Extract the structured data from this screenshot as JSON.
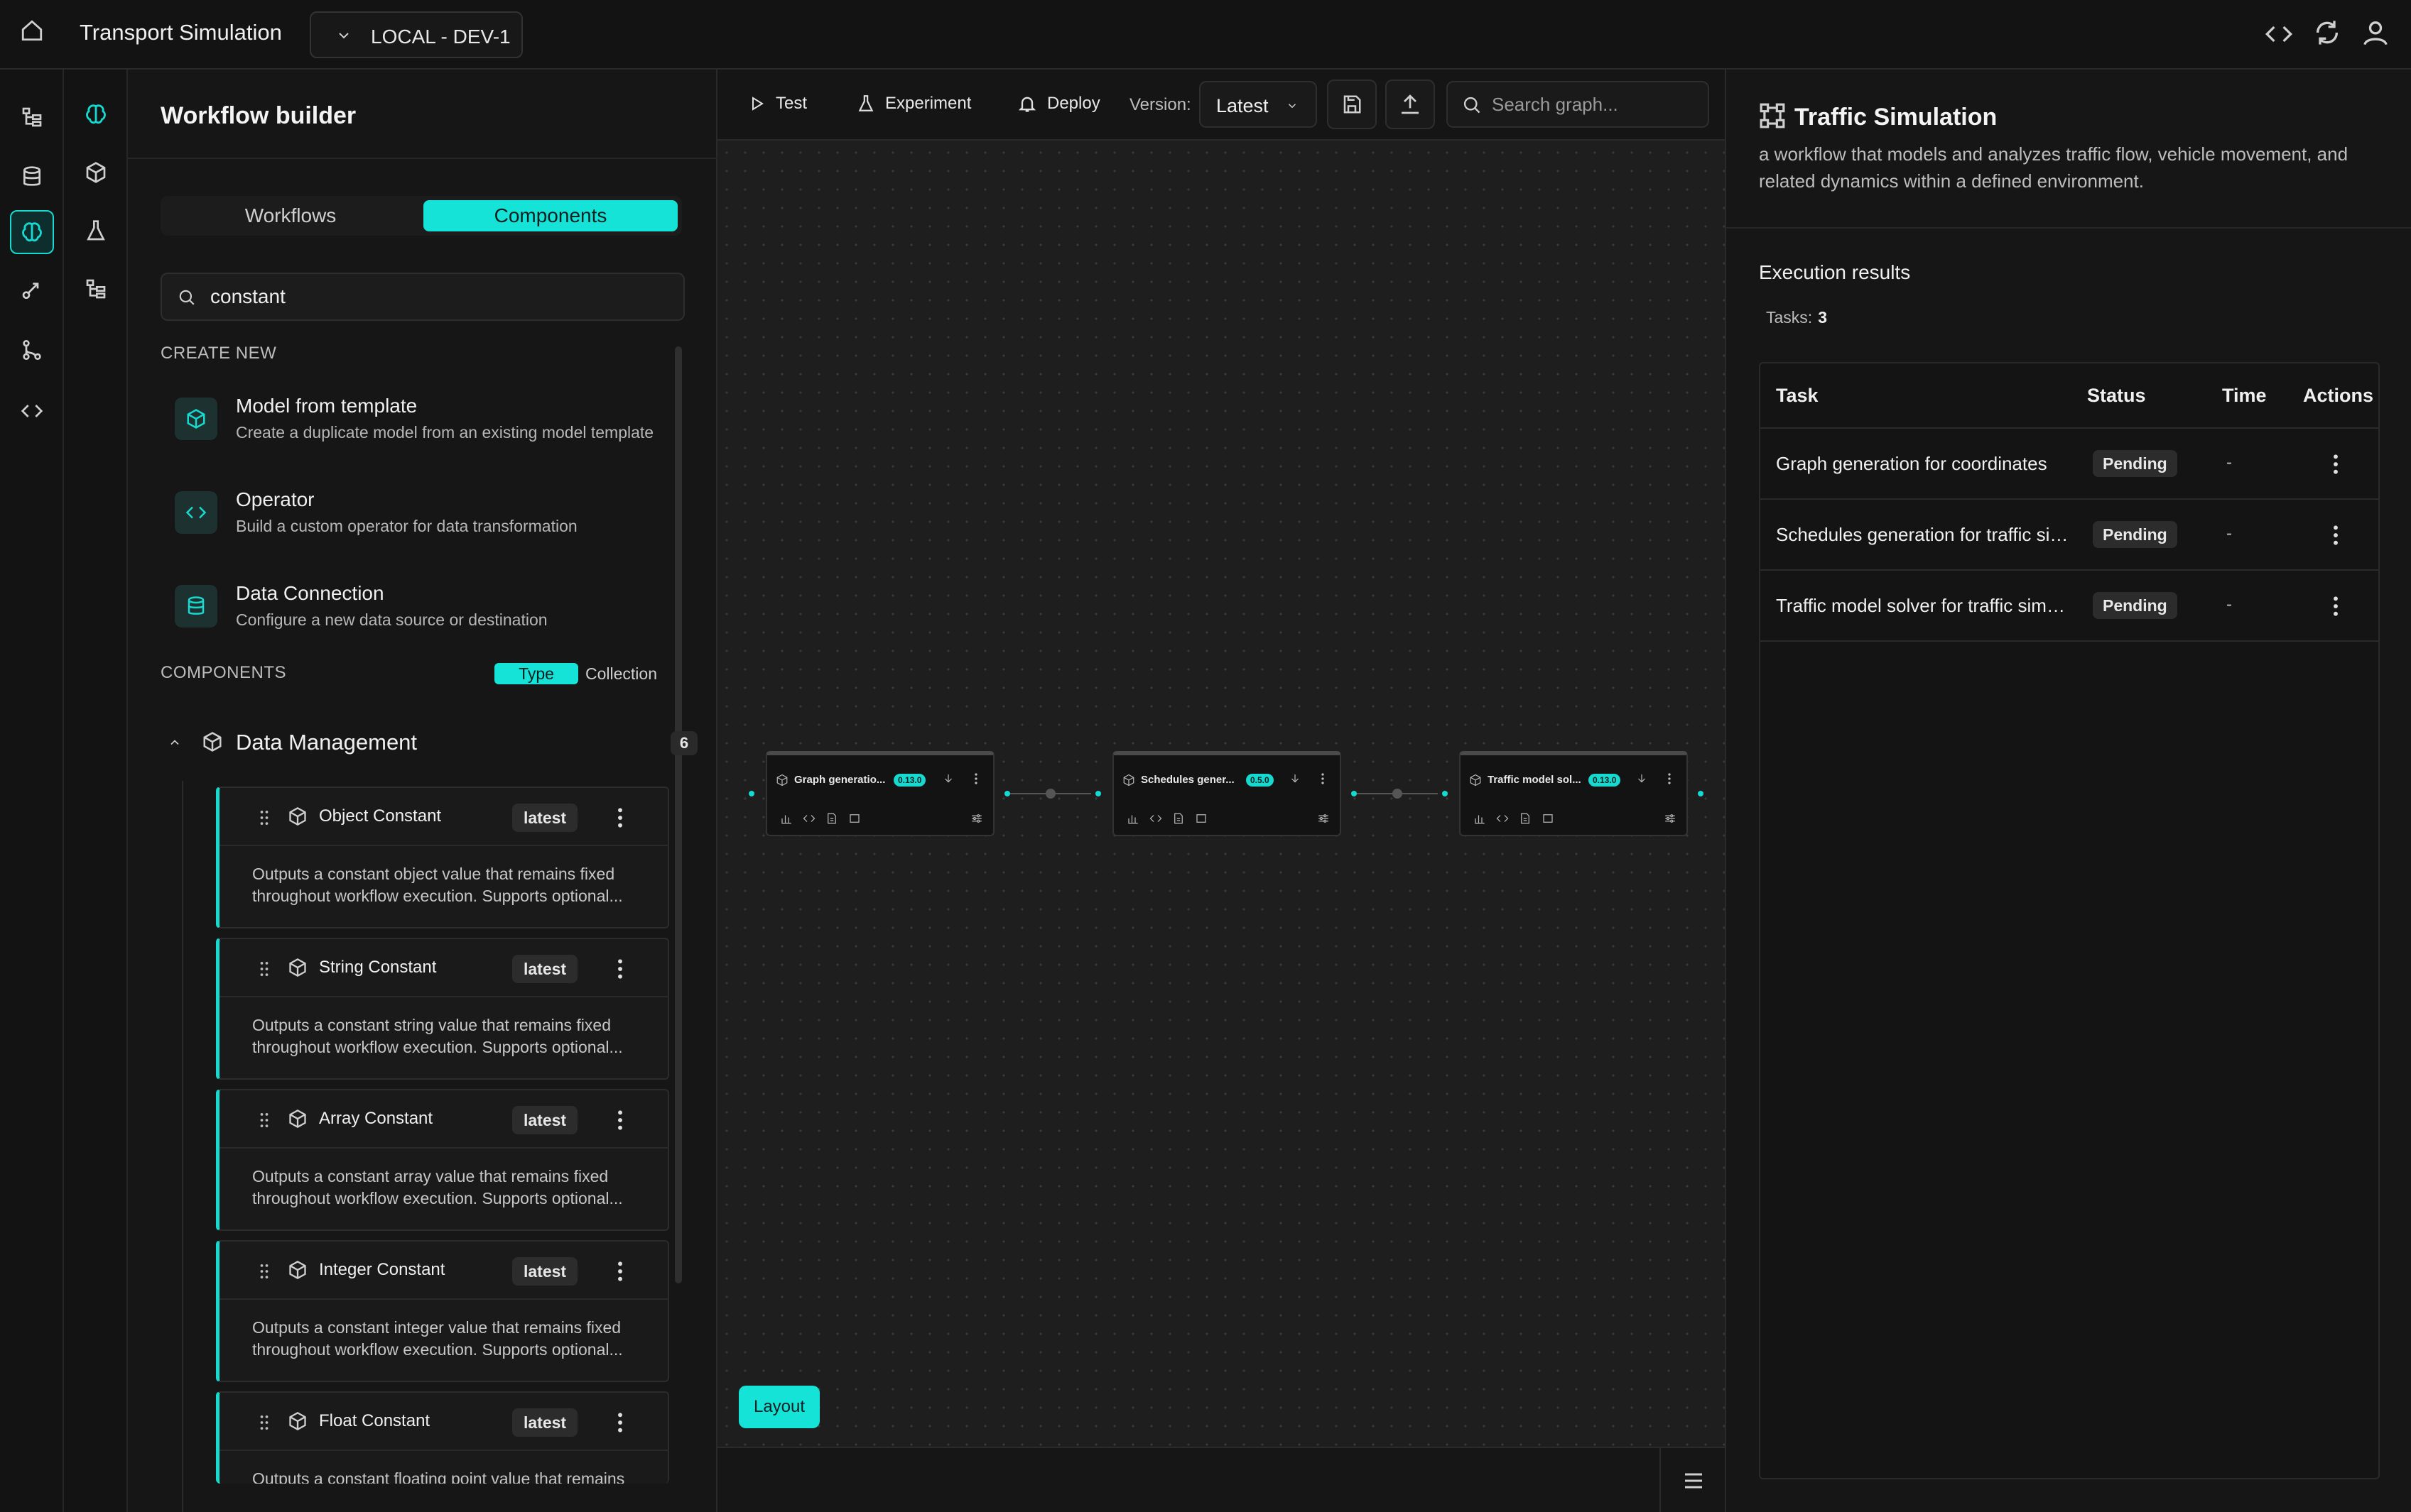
{
  "topbar": {
    "app_title": "Transport Simulation",
    "environment": "LOCAL - DEV-1"
  },
  "left_panel": {
    "title": "Workflow builder",
    "tabs": [
      {
        "label": "Workflows",
        "active": false
      },
      {
        "label": "Components",
        "active": true
      }
    ],
    "search_value": "constant",
    "create_new_label": "CREATE NEW",
    "create_items": [
      {
        "title": "Model from template",
        "desc": "Create a duplicate model from an existing model template",
        "icon": "cube-icon"
      },
      {
        "title": "Operator",
        "desc": "Build a custom operator for data transformation",
        "icon": "code-icon"
      },
      {
        "title": "Data Connection",
        "desc": "Configure a new data source or destination",
        "icon": "database-icon"
      }
    ],
    "components_label": "COMPONENTS",
    "view_toggle": {
      "type": "Type",
      "collection": "Collection",
      "active": "Type"
    },
    "group": {
      "title": "Data Management",
      "count": "6"
    },
    "components": [
      {
        "name": "Object Constant",
        "version": "latest",
        "desc": "Outputs a constant object value that remains fixed throughout workflow execution. Supports optional..."
      },
      {
        "name": "String Constant",
        "version": "latest",
        "desc": "Outputs a constant string value that remains fixed throughout workflow execution. Supports optional..."
      },
      {
        "name": "Array Constant",
        "version": "latest",
        "desc": "Outputs a constant array value that remains fixed throughout workflow execution. Supports optional..."
      },
      {
        "name": "Integer Constant",
        "version": "latest",
        "desc": "Outputs a constant integer value that remains fixed throughout workflow execution. Supports optional..."
      },
      {
        "name": "Float Constant",
        "version": "latest",
        "desc": "Outputs a constant floating point value that remains"
      }
    ]
  },
  "canvas": {
    "toolbar": {
      "test": "Test",
      "experiment": "Experiment",
      "deploy": "Deploy",
      "version_label": "Version:",
      "version_value": "Latest",
      "search_placeholder": "Search graph..."
    },
    "nodes": [
      {
        "title": "Graph generatio...",
        "version": "0.13.0"
      },
      {
        "title": "Schedules gener...",
        "version": "0.5.0"
      },
      {
        "title": "Traffic model sol...",
        "version": "0.13.0"
      }
    ],
    "layout_button": "Layout"
  },
  "right_panel": {
    "title": "Traffic Simulation",
    "description": "a workflow that models and analyzes traffic flow, vehicle movement, and related dynamics within a defined environment.",
    "execution_title": "Execution results",
    "tasks_label": "Tasks:",
    "tasks_count": "3",
    "table": {
      "headers": [
        "Task",
        "Status",
        "Time",
        "Actions"
      ],
      "rows": [
        {
          "task": "Graph generation for coordinates",
          "status": "Pending",
          "time": "-"
        },
        {
          "task": "Schedules generation for traffic simulation",
          "status": "Pending",
          "time": "-"
        },
        {
          "task": "Traffic model solver for traffic simulation",
          "status": "Pending",
          "time": "-"
        }
      ]
    }
  },
  "colors": {
    "accent": "#16e3d8",
    "background": "#131313",
    "panel": "#161616"
  }
}
